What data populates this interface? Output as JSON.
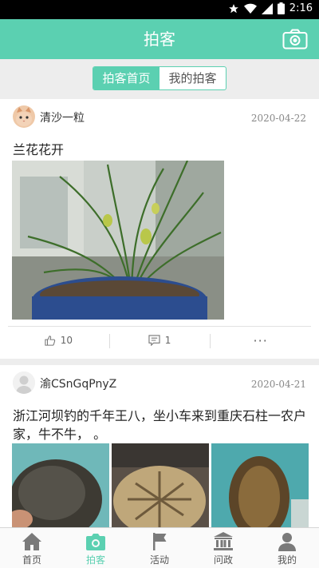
{
  "status_bar": {
    "time": "2:16"
  },
  "header": {
    "title": "拍客",
    "camera_icon": "camera-icon"
  },
  "tabs": [
    {
      "label": "拍客首页",
      "active": true
    },
    {
      "label": "我的拍客",
      "active": false
    }
  ],
  "posts": [
    {
      "user": "清沙一粒",
      "date": "2020-04-22",
      "text": "兰花花开",
      "likes": "10",
      "comments": "1",
      "more": "···"
    },
    {
      "user": "渝CSnGqPnyZ",
      "date": "2020-04-21",
      "text": "浙江河坝钓的千年王八，坐小车来到重庆石柱一农户家，牛不牛，    。"
    }
  ],
  "bottom_nav": [
    {
      "label": "首页",
      "icon": "home-icon",
      "active": false
    },
    {
      "label": "拍客",
      "icon": "camera-icon",
      "active": true
    },
    {
      "label": "活动",
      "icon": "flag-icon",
      "active": false
    },
    {
      "label": "问政",
      "icon": "government-building-icon",
      "active": false
    },
    {
      "label": "我的",
      "icon": "user-icon",
      "active": false
    }
  ],
  "colors": {
    "accent": "#5bd0b1",
    "background": "#ededed"
  }
}
